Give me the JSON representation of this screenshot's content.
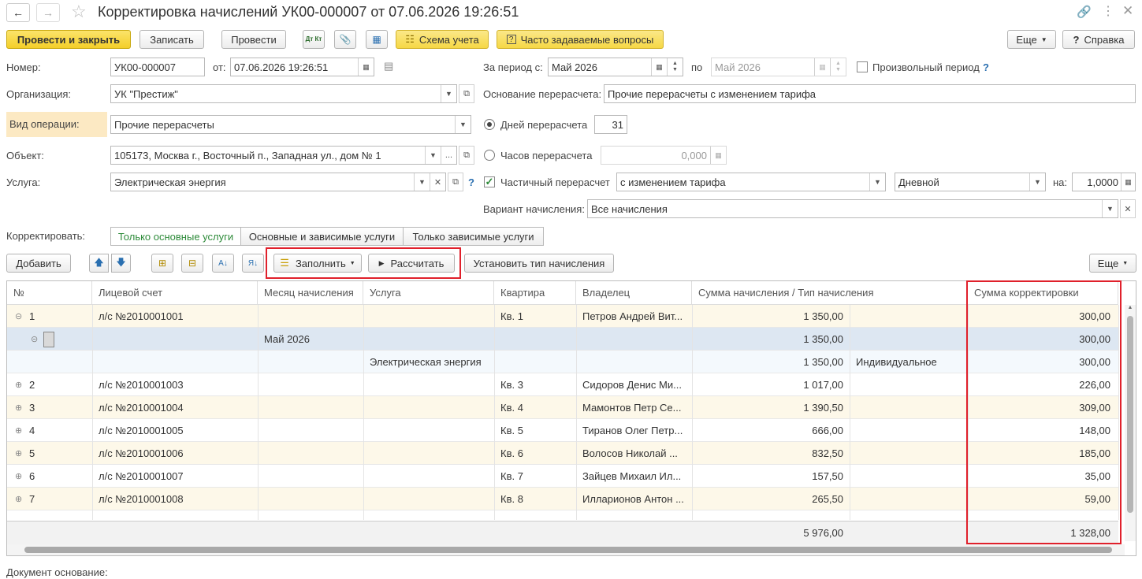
{
  "title": "Корректировка начислений УК00-000007 от 07.06.2026 19:26:51",
  "toolbar": {
    "post_close": "Провести и закрыть",
    "save": "Записать",
    "post": "Провести",
    "dt_kt": "Дт Кт",
    "scheme": "Схема учета",
    "faq": "Часто задаваемые вопросы",
    "more": "Еще",
    "help": "Справка"
  },
  "form": {
    "number_label": "Номер:",
    "number": "УК00-000007",
    "from_label": "от:",
    "date": "07.06.2026 19:26:51",
    "period_from_label": "За период с:",
    "period_from": "Май 2026",
    "period_to_label": "по",
    "period_to": "Май 2026",
    "arbitrary_period": "Произвольный период",
    "org_label": "Организация:",
    "org": "УК \"Престиж\"",
    "basis_label": "Основание перерасчета:",
    "basis": "Прочие перерасчеты с изменением тарифа",
    "op_label": "Вид операции:",
    "op": "Прочие перерасчеты",
    "days_label": "Дней перерасчета",
    "days": "31",
    "object_label": "Объект:",
    "object": "105173, Москва г., Восточный п., Западная ул., дом № 1",
    "hours_label": "Часов перерасчета",
    "hours": "0,000",
    "service_label": "Услуга:",
    "service": "Электрическая энергия",
    "partial_label": "Частичный перерасчет",
    "partial_mode": "с изменением тарифа",
    "tariff_zone": "Дневной",
    "on_label": "на:",
    "coef": "1,0000",
    "variant_label": "Вариант начисления:",
    "variant": "Все начисления",
    "correct_label": "Корректировать:",
    "tabs": [
      "Только основные услуги",
      "Основные и зависимые услуги",
      "Только зависимые услуги"
    ]
  },
  "table_toolbar": {
    "add": "Добавить",
    "fill": "Заполнить",
    "calc": "Рассчитать",
    "set_type": "Установить тип начисления",
    "more": "Еще"
  },
  "table": {
    "headers": [
      "№",
      "Лицевой счет",
      "Месяц начисления",
      "Услуга",
      "Квартира",
      "Владелец",
      "Сумма начисления / Тип начисления",
      "Сумма корректировки"
    ],
    "rows": [
      {
        "n": "1",
        "acc": "л/с №2010001001",
        "month": "",
        "svc": "",
        "flat": "Кв. 1",
        "owner": "Петров Андрей Вит...",
        "sum": "1 350,00",
        "type": "",
        "corr": "300,00"
      },
      {
        "n": "",
        "acc": "",
        "month": "Май 2026",
        "svc": "",
        "flat": "",
        "owner": "",
        "sum": "1 350,00",
        "type": "",
        "corr": "300,00"
      },
      {
        "n": "",
        "acc": "",
        "month": "",
        "svc": "Электрическая энергия",
        "flat": "",
        "owner": "",
        "sum": "1 350,00",
        "type": "Индивидуальное",
        "corr": "300,00"
      },
      {
        "n": "2",
        "acc": "л/с №2010001003",
        "month": "",
        "svc": "",
        "flat": "Кв. 3",
        "owner": "Сидоров Денис Ми...",
        "sum": "1 017,00",
        "type": "",
        "corr": "226,00"
      },
      {
        "n": "3",
        "acc": "л/с №2010001004",
        "month": "",
        "svc": "",
        "flat": "Кв. 4",
        "owner": "Мамонтов Петр Се...",
        "sum": "1 390,50",
        "type": "",
        "corr": "309,00"
      },
      {
        "n": "4",
        "acc": "л/с №2010001005",
        "month": "",
        "svc": "",
        "flat": "Кв. 5",
        "owner": "Тиранов Олег Петр...",
        "sum": "666,00",
        "type": "",
        "corr": "148,00"
      },
      {
        "n": "5",
        "acc": "л/с №2010001006",
        "month": "",
        "svc": "",
        "flat": "Кв. 6",
        "owner": "Волосов Николай ...",
        "sum": "832,50",
        "type": "",
        "corr": "185,00"
      },
      {
        "n": "6",
        "acc": "л/с №2010001007",
        "month": "",
        "svc": "",
        "flat": "Кв. 7",
        "owner": "Зайцев Михаил Ил...",
        "sum": "157,50",
        "type": "",
        "corr": "35,00"
      },
      {
        "n": "7",
        "acc": "л/с №2010001008",
        "month": "",
        "svc": "",
        "flat": "Кв. 8",
        "owner": "Илларионов Антон ...",
        "sum": "265,50",
        "type": "",
        "corr": "59,00"
      }
    ],
    "total_sum": "5 976,00",
    "total_corr": "1 328,00"
  },
  "footer_label": "Документ основание:"
}
